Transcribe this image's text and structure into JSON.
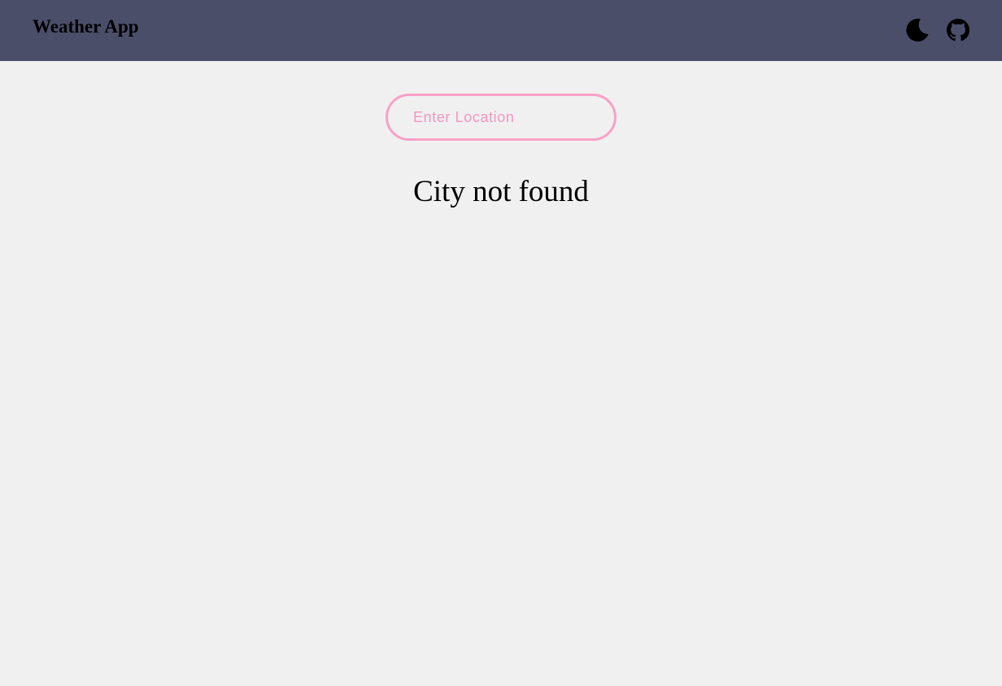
{
  "header": {
    "title": "Weather App",
    "background_color": "#4a4e69",
    "icons": [
      "moon-icon",
      "github-icon"
    ]
  },
  "search": {
    "value": "",
    "placeholder": "Enter Location",
    "border_color": "#f9a0c8"
  },
  "status": {
    "message": "City not found"
  },
  "page": {
    "background_color": "#f0f0f0"
  }
}
